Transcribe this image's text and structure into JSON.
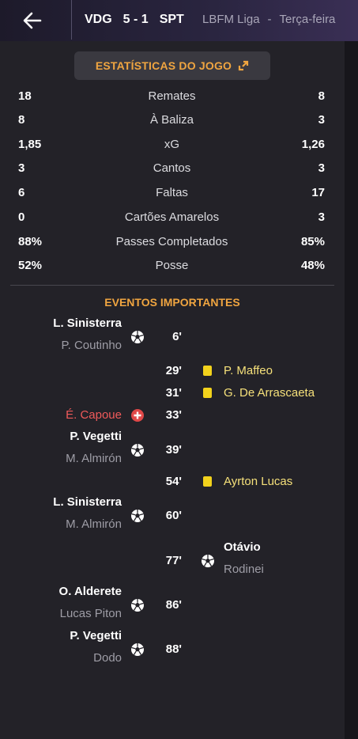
{
  "header": {
    "home": "VDG",
    "score": "5 - 1",
    "away": "SPT",
    "competition": "LBFM Liga",
    "separator": "-",
    "day": "Terça-feira"
  },
  "stats_button": {
    "label": "ESTATÍSTICAS DO JOGO"
  },
  "stats": [
    {
      "name": "Remates",
      "home": "18",
      "away": "8"
    },
    {
      "name": "À Baliza",
      "home": "8",
      "away": "3"
    },
    {
      "name": "xG",
      "home": "1,85",
      "away": "1,26"
    },
    {
      "name": "Cantos",
      "home": "3",
      "away": "3"
    },
    {
      "name": "Faltas",
      "home": "6",
      "away": "17"
    },
    {
      "name": "Cartões Amarelos",
      "home": "0",
      "away": "3"
    },
    {
      "name": "Passes Completados",
      "home": "88%",
      "away": "85%"
    },
    {
      "name": "Posse",
      "home": "52%",
      "away": "48%"
    }
  ],
  "events_title": "EVENTOS IMPORTANTES",
  "events": [
    {
      "minute": "6'",
      "scorer": "L. Sinisterra",
      "assist": "P. Coutinho",
      "type": "goal",
      "side": "home"
    },
    {
      "minute": "29'",
      "player": "P. Maffeo",
      "type": "yellow",
      "side": "away"
    },
    {
      "minute": "31'",
      "player": "G. De Arrascaeta",
      "type": "yellow",
      "side": "away"
    },
    {
      "minute": "33'",
      "player": "É. Capoue",
      "type": "injury",
      "side": "home"
    },
    {
      "minute": "39'",
      "scorer": "P. Vegetti",
      "assist": "M. Almirón",
      "type": "goal",
      "side": "home"
    },
    {
      "minute": "54'",
      "player": "Ayrton Lucas",
      "type": "yellow",
      "side": "away"
    },
    {
      "minute": "60'",
      "scorer": "L. Sinisterra",
      "assist": "M. Almirón",
      "type": "goal",
      "side": "home"
    },
    {
      "minute": "77'",
      "scorer": "Otávio",
      "assist": "Rodinei",
      "type": "goal",
      "side": "away"
    },
    {
      "minute": "86'",
      "scorer": "O. Alderete",
      "assist": "Lucas Piton",
      "type": "goal",
      "side": "home"
    },
    {
      "minute": "88'",
      "scorer": "P. Vegetti",
      "assist": "Dodo",
      "type": "goal",
      "side": "home"
    }
  ],
  "colors": {
    "accent": "#f0a540",
    "yellow_card": "#f2d21c",
    "red_event": "#f05a5a",
    "background": "#232228"
  }
}
